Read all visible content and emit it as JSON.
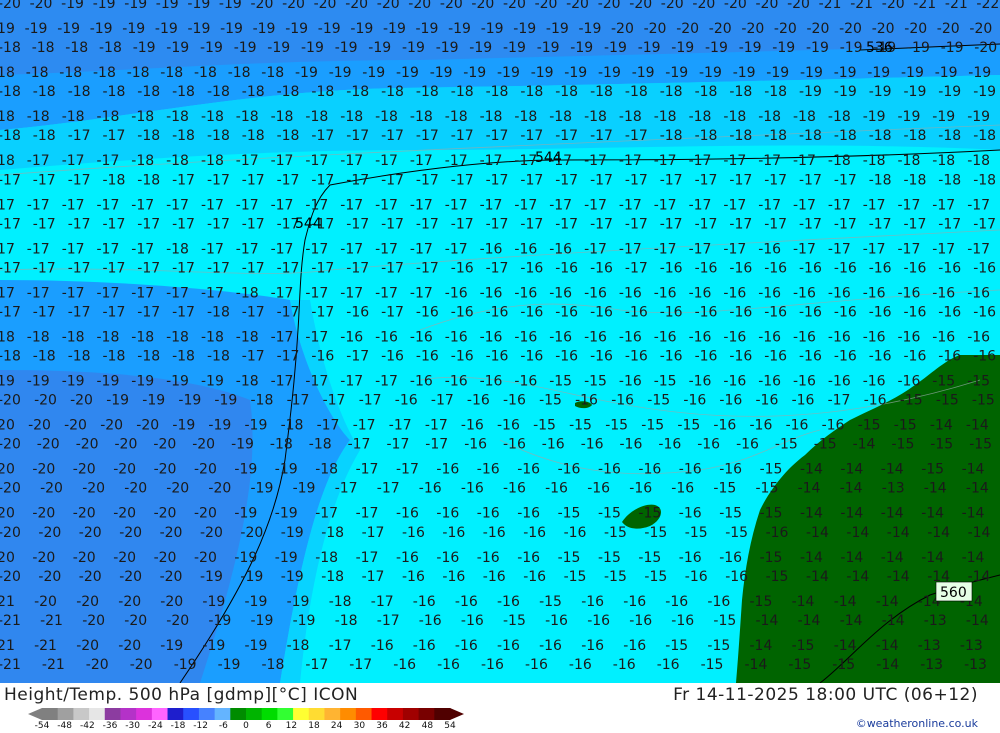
{
  "map": {
    "ocean_colors": {
      "cold_18": "#1e90ff",
      "cold_19": "#3c8ee6",
      "cyan_17": "#0fe9f5",
      "cyan_16": "#00f3ff"
    },
    "land_color": "#006400",
    "label_color": "#1a1a1a",
    "contour_color": "#000000",
    "height_labels": [
      "544",
      "544",
      "536",
      "560"
    ],
    "temp_rows": [
      "20 20 19 19 19 19 19 19 20 20 20 20 20 20 20 20 20 20 20 20 20 20 20 20 20 20 21 21 20 21 21 22",
      "19 19 19 19 19 19 19 19 19 19 19 19 19 19 19 19 19 19 19 20 20 20 20 20 20 20 20 20 20 20 20",
      "18 18 18 18 19 19 19 19 19 19 19 19 19 19 19 19 19 19 19 19 19 19 19 19 19 19 19 19 19 20",
      "18 18 18 18 18 18 18 18 18 19 19 19 19 19 19 19 19 19 19 19 19 19 19 19 19 19 19 19 19 19",
      "18 18 18 18 18 18 18 18 18 18 18 18 18 18 18 18 18 18 18 18 18 18 18 19 19 19 19 19 19",
      "18 18 18 18 18 18 18 18 18 18 18 18 18 18 18 18 18 18 18 18 18 18 18 18 18 19 19 19 19",
      "18 18 17 17 18 18 18 18 18 17 17 17 17 17 17 17 17 17 17 18 18 18 18 18 18 18 18 18 18",
      "18 17 17 17 18 18 18 17 17 17 17 17 17 17 17 17 17 17 17 17 17 17 17 17 18 18 18 18 18",
      "17 17 17 18 18 17 17 17 17 17 17 17 17 17 17 17 17 17 17 17 17 17 17 17 17 18 18 18 18",
      "17 17 17 17 17 17 17 17 17 17 17 17 17 17 17 17 17 17 17 17 17 17 17 17 17 17 17 17 17",
      "17 17 17 17 17 17 17 17 17 17 17 17 17 17 17 17 17 17 17 17 17 17 17 17 17 17 17 17 17",
      "17 17 17 17 17 18 17 17 17 17 17 17 17 17 16 16 16 17 17 17 17 17 16 17 17 17 17 17 17",
      "17 17 17 17 17 17 17 17 17 17 17 17 17 16 17 16 16 16 17 16 16 16 16 16 16 16 16 16 16",
      "17 17 17 17 17 17 17 18 17 17 17 17 17 16 16 16 16 16 16 16 16 16 16 16 16 16 16 16 16",
      "17 17 17 17 17 17 18 17 17 17 16 17 16 16 16 16 16 16 16 16 16 16 16 16 16 16 16 16 16",
      "18 18 18 18 18 18 18 18 17 17 16 16 16 16 16 16 16 16 16 16 16 16 16 16 16 16 16 16 16",
      "18 18 18 18 18 18 18 17 17 16 17 16 16 16 16 16 16 16 16 16 16 16 16 16 16 16 16 16 16",
      "19 19 19 19 19 19 19 18 17 17 17 17 16 16 16 16 15 15 16 15 16 16 16 16 16 16 16 15 15",
      "20 20 20 19 19 19 19 18 17 17 17 16 17 16 16 15 16 16 15 16 16 16 16 17 16 15 15 15",
      "20 20 20 20 20 19 19 19 18 17 17 17 17 16 16 15 15 15 15 15 16 16 16 16 15 15 14 14",
      "20 20 20 20 20 20 19 18 18 17 17 17 16 16 16 16 16 16 16 16 15 15 14 15 15 15",
      "20 20 20 20 20 20 19 19 18 17 17 16 16 16 16 16 16 16 16 15 14 14 14 15 14",
      "20 20 20 20 20 20 19 19 17 17 16 16 16 16 16 16 16 15 15 14 14 13 14 14",
      "20 20 20 20 20 20 19 19 17 17 16 16 16 16 15 15 15 16 15 15 14 14 14 14 14",
      "20 20 20 20 20 20 20 19 18 17 16 16 16 16 16 15 15 15 15 16 14 14 14 14 14",
      "20 20 20 20 20 20 19 19 18 17 16 16 16 16 15 15 15 16 16 15 14 14 14 14 14",
      "20 20 20 20 20 19 19 19 18 17 16 16 16 16 15 15 15 16 16 15 14 14 14 14 14",
      "21 20 20 20 20 19 19 19 18 17 16 16 16 15 16 16 16 16 15 14 14 14 14 14",
      "21 21 20 20 20 19 19 19 18 17 16 16 15 16 16 16 16 15 14 14 14 14 13 14",
      "21 21 20 20 19 19 19 18 17 16 16 16 16 16 16 16 15 15 14 15 14 14 13 13",
      "21 21 20 20 19 19 18 17 17 16 16 16 16 16 16 16 15 14 15 15 14 13 13"
    ]
  },
  "footer": {
    "title": "Height/Temp. 500 hPa [gdmp][°C] ICON",
    "time": "Fr 14-11-2025 18:00 UTC (06+12)",
    "credit": "©weatheronline.co.uk"
  },
  "colorbar": {
    "ticks": [
      "-54",
      "-48",
      "-42",
      "-36",
      "-30",
      "-24",
      "-18",
      "-12",
      "-6",
      "0",
      "6",
      "12",
      "18",
      "24",
      "30",
      "36",
      "42",
      "48",
      "54"
    ],
    "colors": [
      "#808080",
      "#a0a0a0",
      "#c8c8c8",
      "#e6e6e6",
      "#8c3ca0",
      "#b432c8",
      "#dc32dc",
      "#ff64ff",
      "#1e1ecd",
      "#2850ff",
      "#4682ff",
      "#64b4ff",
      "#008c00",
      "#00b400",
      "#00dc00",
      "#32ff32",
      "#ffff32",
      "#ffdc32",
      "#ffb432",
      "#ff8c00",
      "#ff5a00",
      "#ff0000",
      "#c80000",
      "#a00000",
      "#780000",
      "#500000"
    ]
  }
}
